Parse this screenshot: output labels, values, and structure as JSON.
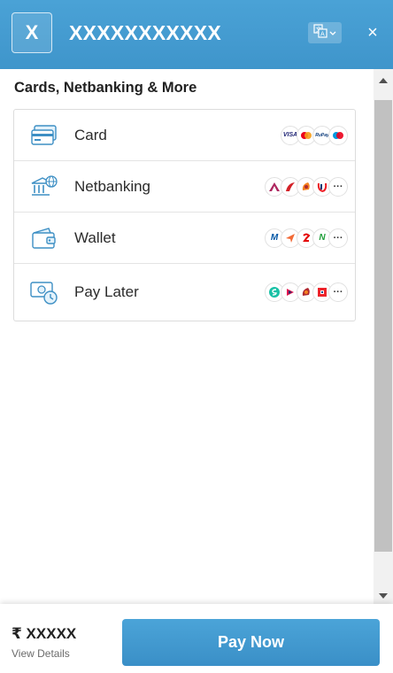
{
  "header": {
    "logo_letter": "X",
    "merchant_name": "XXXXXXXXXXX",
    "close_symbol": "×",
    "colors": {
      "bar": "#4aa2d6"
    }
  },
  "section": {
    "title": "Cards, Netbanking & More"
  },
  "methods": [
    {
      "label": "Card",
      "icon": "card-icon",
      "logos": [
        "visa-logo",
        "mastercard-logo",
        "rupay-logo",
        "maestro-logo"
      ],
      "more": ""
    },
    {
      "label": "Netbanking",
      "icon": "bank-icon",
      "logos": [
        "axis-bank-logo",
        "hdfc-bank-logo",
        "icici-bank-logo",
        "kotak-bank-logo"
      ],
      "more": "···"
    },
    {
      "label": "Wallet",
      "icon": "wallet-icon",
      "logos": [
        "mobikwik-logo",
        "freecharge-logo",
        "airtel-money-logo",
        "jiomoney-logo"
      ],
      "more": "···"
    },
    {
      "label": "Pay Later",
      "icon": "paylater-icon",
      "logos": [
        "simpl-logo",
        "lazypay-logo",
        "icici-paylater-logo",
        "hdfc-paylater-logo"
      ],
      "more": "···"
    }
  ],
  "footer": {
    "amount": "₹ XXXXX",
    "view_details": "View Details",
    "pay_button": "Pay Now"
  }
}
